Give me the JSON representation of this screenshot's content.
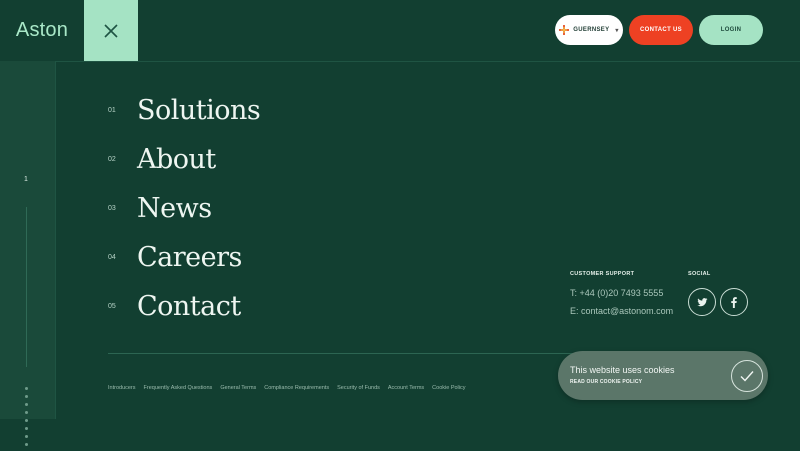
{
  "header": {
    "logo": "Aston",
    "location_label": "GUERNSEY",
    "contact_label": "CONTACT US",
    "login_label": "LOGIN"
  },
  "rail": {
    "number": "1"
  },
  "menu": [
    {
      "num": "01",
      "label": "Solutions"
    },
    {
      "num": "02",
      "label": "About"
    },
    {
      "num": "03",
      "label": "News"
    },
    {
      "num": "04",
      "label": "Careers"
    },
    {
      "num": "05",
      "label": "Contact"
    }
  ],
  "support": {
    "title": "CUSTOMER SUPPORT",
    "phone": "T: +44 (0)20 7493 5555",
    "email": "E: contact@astonom.com"
  },
  "social": {
    "title": "SOCIAL",
    "icons": [
      "twitter-icon",
      "facebook-icon"
    ]
  },
  "footer": {
    "links": [
      "Introducers",
      "Frequently Asked Questions",
      "General Terms",
      "Compliance Requirements",
      "Security of Funds",
      "Account Terms",
      "Cookie Policy"
    ]
  },
  "cookie": {
    "title": "This website uses cookies",
    "policy": "READ OUR COOKIE POLICY"
  },
  "colors": {
    "background": "#123f31",
    "accent": "#a5e3c4",
    "contact": "#ee4123"
  }
}
